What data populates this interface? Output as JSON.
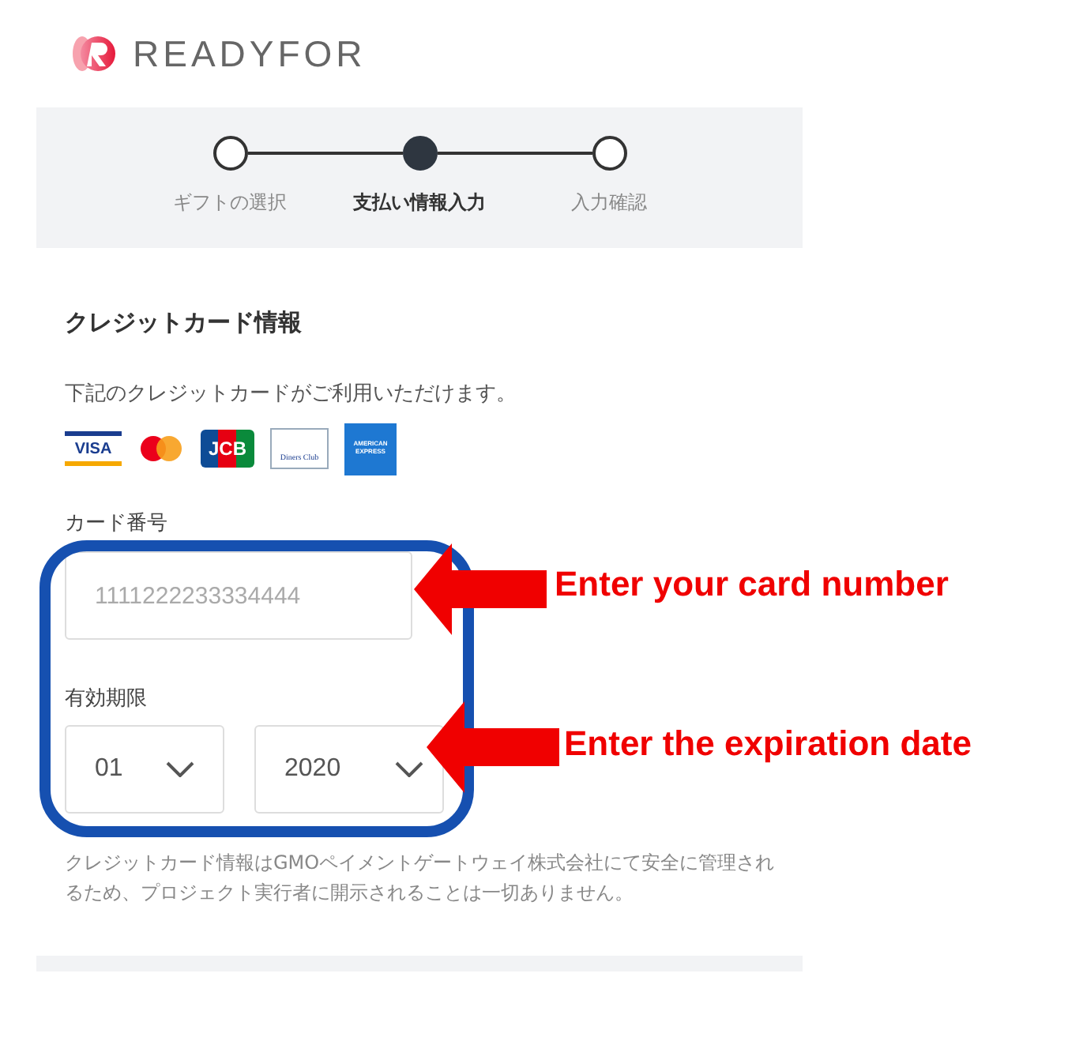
{
  "header": {
    "logo_text": "READYFOR"
  },
  "steps": [
    {
      "label": "ギフトの選択",
      "selected": false
    },
    {
      "label": "支払い情報入力",
      "selected": true
    },
    {
      "label": "入力確認",
      "selected": false
    }
  ],
  "section": {
    "title": "クレジットカード情報",
    "description": "下記のクレジットカードがご利用いただけます。"
  },
  "cards": [
    {
      "kind": "visa",
      "label": "VISA"
    },
    {
      "kind": "mastercard"
    },
    {
      "kind": "jcb",
      "label": "JCB"
    },
    {
      "kind": "diners",
      "label": "Diners Club"
    },
    {
      "kind": "amex",
      "label": "AMERICAN EXPRESS"
    }
  ],
  "card_number": {
    "label": "カード番号",
    "placeholder": "1111222233334444"
  },
  "expiry": {
    "label": "有効期限",
    "month": "01",
    "year": "2020"
  },
  "notice": "クレジットカード情報はGMOペイメントゲートウェイ株式会社にて安全に管理されるため、プロジェクト実行者に開示されることは一切ありません。",
  "annotations": [
    "Enter your card number",
    "Enter the expiration date"
  ]
}
